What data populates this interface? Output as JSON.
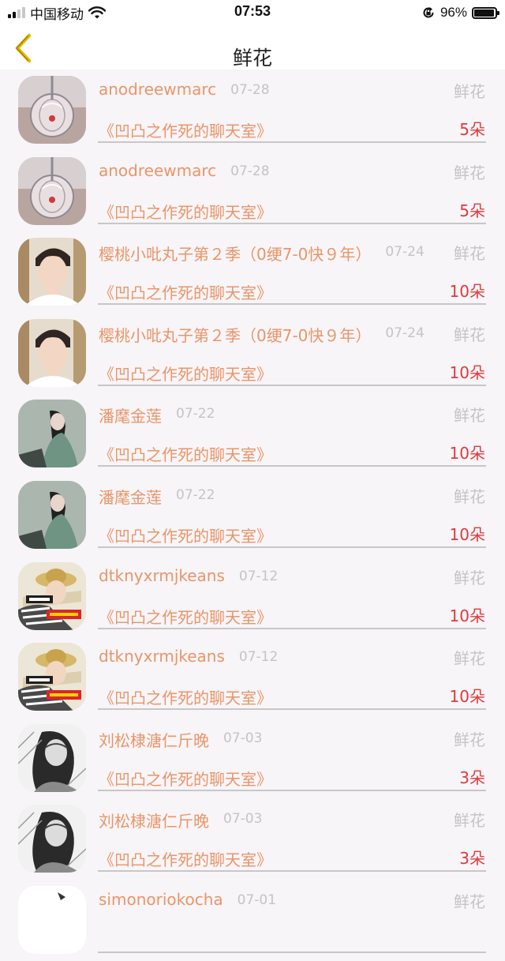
{
  "status_bar": {
    "carrier": "中国移动",
    "time": "07:53",
    "battery_text": "96%",
    "battery_level": 0.96
  },
  "nav": {
    "title": "鲜花",
    "back_icon": "chevron-left-icon"
  },
  "colors": {
    "accent": "#e9956a",
    "count": "#e0393e",
    "muted": "#c4c4c4",
    "back": "#e6b800"
  },
  "items": [
    {
      "name": "anodreewmarc",
      "date": "07-28",
      "gift": "鲜花",
      "room": "《凹凸之作死的聊天室》",
      "count": "5朵",
      "avatar": "glass-ornament"
    },
    {
      "name": "anodreewmarc",
      "date": "07-28",
      "gift": "鲜花",
      "room": "《凹凸之作死的聊天室》",
      "count": "5朵",
      "avatar": "glass-ornament"
    },
    {
      "name": "樱桃小吡丸子第２季（0绠7-0快９年）",
      "date": "07-24",
      "gift": "鲜花",
      "room": "《凹凸之作死的聊天室》",
      "count": "10朵",
      "avatar": "boy-portrait"
    },
    {
      "name": "樱桃小吡丸子第２季（0绠7-0快９年）",
      "date": "07-24",
      "gift": "鲜花",
      "room": "《凹凸之作死的聊天室》",
      "count": "10朵",
      "avatar": "boy-portrait"
    },
    {
      "name": "潘麾金莲",
      "date": "07-22",
      "gift": "鲜花",
      "room": "《凹凸之作死的聊天室》",
      "count": "10朵",
      "avatar": "woman-green-dress"
    },
    {
      "name": "潘麾金莲",
      "date": "07-22",
      "gift": "鲜花",
      "room": "《凹凸之作死的聊天室》",
      "count": "10朵",
      "avatar": "woman-green-dress"
    },
    {
      "name": "dtknyxrmjkeans",
      "date": "07-12",
      "gift": "鲜花",
      "room": "《凹凸之作死的聊天室》",
      "count": "10朵",
      "avatar": "girl-straw-hat"
    },
    {
      "name": "dtknyxrmjkeans",
      "date": "07-12",
      "gift": "鲜花",
      "room": "《凹凸之作死的聊天室》",
      "count": "10朵",
      "avatar": "girl-straw-hat"
    },
    {
      "name": "刘松棣溏仁斤晚",
      "date": "07-03",
      "gift": "鲜花",
      "room": "《凹凸之作死的聊天室》",
      "count": "3朵",
      "avatar": "bw-woman"
    },
    {
      "name": "刘松棣溏仁斤晚",
      "date": "07-03",
      "gift": "鲜花",
      "room": "《凹凸之作死的聊天室》",
      "count": "3朵",
      "avatar": "bw-woman"
    },
    {
      "name": "simonoriokocha",
      "date": "07-01",
      "gift": "鲜花",
      "room": "",
      "count": "",
      "avatar": "blank"
    }
  ]
}
